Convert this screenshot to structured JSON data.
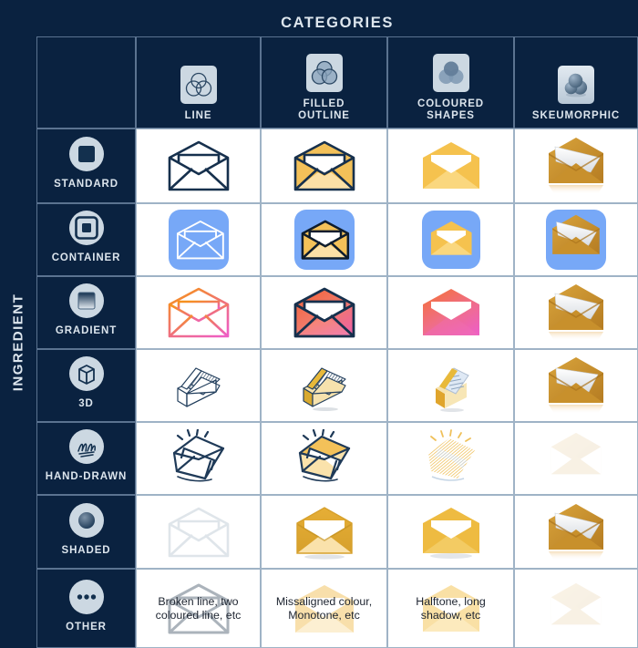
{
  "header": {
    "title": "CATEGORIES"
  },
  "side": {
    "title": "INGREDIENT"
  },
  "columns": [
    {
      "key": "line",
      "label": "LINE",
      "icon": "venn-line-icon"
    },
    {
      "key": "filled",
      "label": "FILLED\nOUTLINE",
      "label_l1": "FILLED",
      "label_l2": "OUTLINE",
      "icon": "venn-filled-outline-icon"
    },
    {
      "key": "coloured",
      "label": "COLOURED\nSHAPES",
      "label_l1": "COLOURED",
      "label_l2": "SHAPES",
      "icon": "venn-coloured-shapes-icon"
    },
    {
      "key": "skeu",
      "label": "SKEUMORPHIC",
      "icon": "spheres-skeumorphic-icon"
    }
  ],
  "rows": [
    {
      "key": "standard",
      "label": "STANDARD",
      "icon": "square-standard-icon"
    },
    {
      "key": "container",
      "label": "CONTAINER",
      "icon": "square-in-circle-container-icon"
    },
    {
      "key": "gradient",
      "label": "GRADIENT",
      "icon": "gradient-square-icon"
    },
    {
      "key": "3d",
      "label": "3D",
      "icon": "cube-3d-icon"
    },
    {
      "key": "handdrawn",
      "label": "HAND-DRAWN",
      "icon": "scribble-hand-drawn-icon"
    },
    {
      "key": "shaded",
      "label": "SHADED",
      "icon": "sphere-shaded-icon"
    },
    {
      "key": "other",
      "label": "OTHER",
      "icon": "ellipsis-other-icon"
    }
  ],
  "cells": {
    "other": {
      "line": "Broken line, two coloured line, etc",
      "filled": "Missaligned colour, Monotone, etc",
      "coloured": "Halftone, long shadow, etc",
      "skeu": ""
    }
  },
  "colors": {
    "background": "#0a2240",
    "grid_line_dark": "#5b7390",
    "grid_line_light": "#9fb3c6",
    "cell_background": "#ffffff",
    "header_text": "#dce5ed",
    "ink_navy": "#16304d",
    "envelope_yellow": "#f5c24e",
    "envelope_yellow_light": "#fbe0a6",
    "container_blue": "#77a8f7",
    "gradient_orange": "#f6911e",
    "gradient_pink": "#ef5fa8",
    "gradient_red": "#f4633a",
    "skeu_gold": "#c8902c",
    "thumb_plate": "#ccd8e2"
  }
}
